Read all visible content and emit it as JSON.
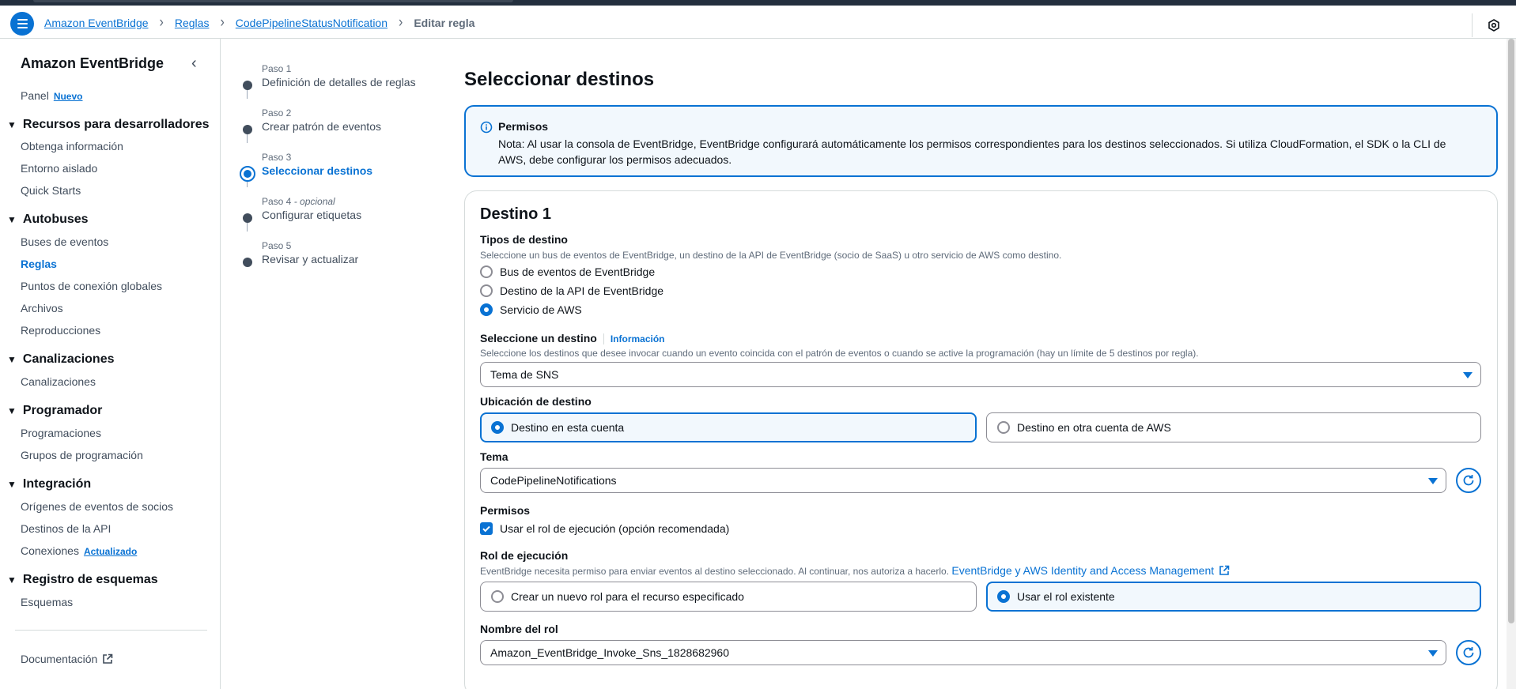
{
  "breadcrumb": {
    "items": [
      "Amazon EventBridge",
      "Reglas",
      "CodePipelineStatusNotification"
    ],
    "current": "Editar regla"
  },
  "sidebar": {
    "title": "Amazon EventBridge",
    "panel": {
      "label": "Panel",
      "badge": "Nuevo"
    },
    "groups": [
      {
        "label": "Recursos para desarrolladores",
        "items": [
          "Obtenga información",
          "Entorno aislado",
          "Quick Starts"
        ]
      },
      {
        "label": "Autobuses",
        "items": [
          "Buses de eventos",
          "Reglas",
          "Puntos de conexión globales",
          "Archivos",
          "Reproducciones"
        ]
      },
      {
        "label": "Canalizaciones",
        "items": [
          "Canalizaciones"
        ]
      },
      {
        "label": "Programador",
        "items": [
          "Programaciones",
          "Grupos de programación"
        ]
      },
      {
        "label": "Integración",
        "items": [
          "Orígenes de eventos de socios",
          "Destinos de la API",
          "Conexiones"
        ]
      },
      {
        "label": "Registro de esquemas",
        "items": [
          "Esquemas"
        ]
      }
    ],
    "conexiones_badge": "Actualizado",
    "active_item": "Reglas",
    "documentation": "Documentación"
  },
  "steps": [
    {
      "label": "Paso 1",
      "optional": "",
      "name": "Definición de detalles de reglas"
    },
    {
      "label": "Paso 2",
      "optional": "",
      "name": "Crear patrón de eventos"
    },
    {
      "label": "Paso 3",
      "optional": "",
      "name": "Seleccionar destinos"
    },
    {
      "label": "Paso 4",
      "optional": " - opcional",
      "name": "Configurar etiquetas"
    },
    {
      "label": "Paso 5",
      "optional": "",
      "name": "Revisar y actualizar"
    }
  ],
  "main": {
    "title": "Seleccionar destinos",
    "info": {
      "title": "Permisos",
      "text": "Nota: Al usar la consola de EventBridge, EventBridge configurará automáticamente los permisos correspondientes para los destinos seleccionados. Si utiliza CloudFormation, el SDK o la CLI de AWS, debe configurar los permisos adecuados."
    },
    "target": {
      "title": "Destino 1",
      "types_label": "Tipos de destino",
      "types_desc": "Seleccione un bus de eventos de EventBridge, un destino de la API de EventBridge (socio de SaaS) u otro servicio de AWS como destino.",
      "types": [
        "Bus de eventos de EventBridge",
        "Destino de la API de EventBridge",
        "Servicio de AWS"
      ],
      "select_label": "Seleccione un destino",
      "select_info": "Información",
      "select_desc": "Seleccione los destinos que desee invocar cuando un evento coincida con el patrón de eventos o cuando se active la programación (hay un límite de 5 destinos por regla).",
      "select_value": "Tema de SNS",
      "location_label": "Ubicación de destino",
      "location_options": [
        "Destino en esta cuenta",
        "Destino en otra cuenta de AWS"
      ],
      "topic_label": "Tema",
      "topic_value": "CodePipelineNotifications",
      "perm_label": "Permisos",
      "perm_checkbox": "Usar el rol de ejecución (opción recomendada)",
      "role_label": "Rol de ejecución",
      "role_desc": "EventBridge necesita permiso para enviar eventos al destino seleccionado. Al continuar, nos autoriza a hacerlo.",
      "role_link": "EventBridge y AWS Identity and Access Management",
      "role_options": [
        "Crear un nuevo rol para el recurso especificado",
        "Usar el rol existente"
      ],
      "role_name_label": "Nombre del rol",
      "role_name_value": "Amazon_EventBridge_Invoke_Sns_1828682960"
    }
  },
  "colors": {
    "accent": "#0972d3",
    "info_bg": "#f2f8fd",
    "topbar": "#232f3e"
  }
}
